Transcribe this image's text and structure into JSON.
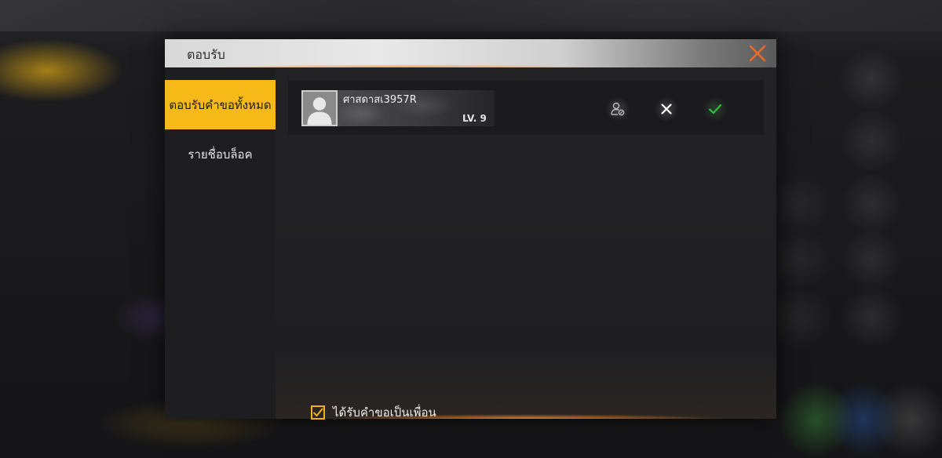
{
  "dialog": {
    "title": "ตอบรับ",
    "close_icon": "close-icon"
  },
  "sidebar": {
    "items": [
      {
        "label": "ตอบรับคำขอทั้งหมด",
        "active": true
      },
      {
        "label": "รายชื่อบล็อค",
        "active": false
      }
    ]
  },
  "requests": [
    {
      "username": "ศาสดาสเ3957R",
      "level": "LV. 9",
      "avatar_icon": "person-avatar-icon",
      "actions": [
        "view-profile-icon",
        "reject-icon",
        "accept-icon"
      ]
    }
  ],
  "settings": {
    "receive_requests_label": "ได้รับคำขอเป็นเพื่อน",
    "receive_requests_checked": true
  },
  "colors": {
    "accent": "#f6b918",
    "close": "#ee6a2a",
    "accept": "#29c23a"
  }
}
